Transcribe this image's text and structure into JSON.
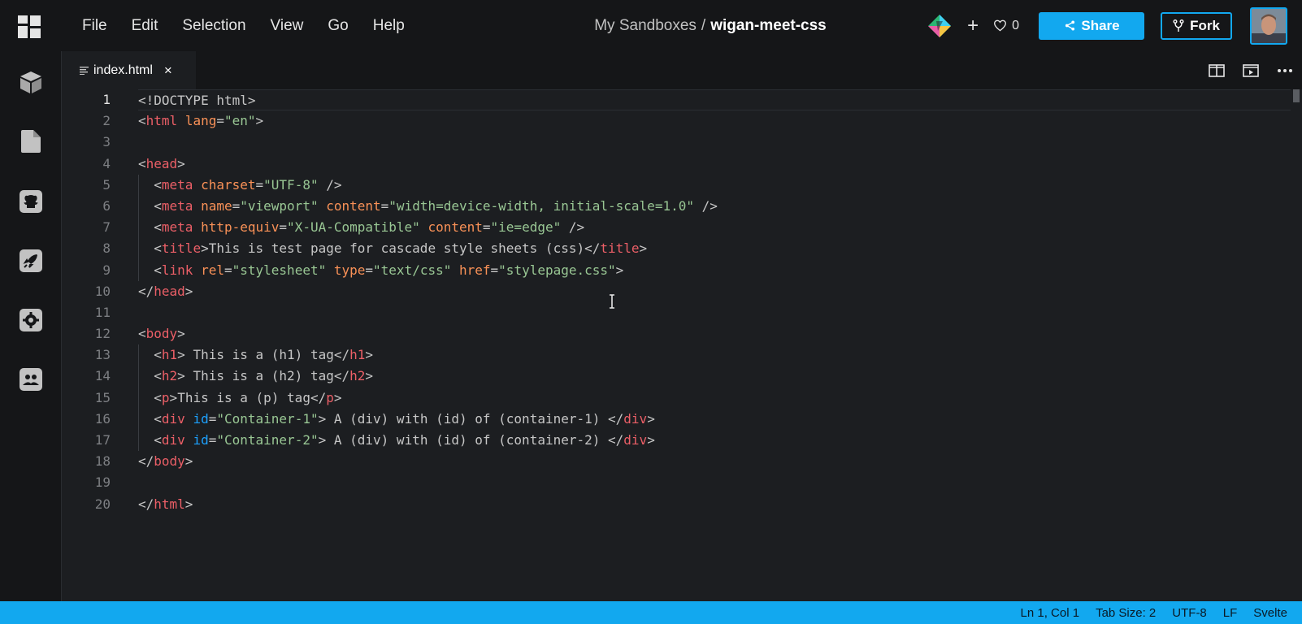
{
  "menubar": {
    "items": [
      "File",
      "Edit",
      "Selection",
      "View",
      "Go",
      "Help"
    ],
    "breadcrumb": {
      "parent": "My Sandboxes",
      "separator": "/",
      "name": "wigan-meet-css"
    },
    "likes": "0",
    "share_label": "Share",
    "fork_label": "Fork"
  },
  "activity_bar": {
    "icons": [
      "cube-icon",
      "file-icon",
      "github-icon",
      "rocket-icon",
      "gear-icon",
      "people-icon"
    ]
  },
  "tab": {
    "label": "index.html",
    "close": "×"
  },
  "editor": {
    "line_numbers": [
      "1",
      "2",
      "3",
      "4",
      "5",
      "6",
      "7",
      "8",
      "9",
      "10",
      "11",
      "12",
      "13",
      "14",
      "15",
      "16",
      "17",
      "18",
      "19",
      "20"
    ],
    "active_line": 1
  },
  "status": {
    "position": "Ln 1, Col 1",
    "tab_size": "Tab Size: 2",
    "encoding": "UTF-8",
    "eol": "LF",
    "language": "Svelte"
  },
  "colors": {
    "accent": "#12a8ef",
    "tag": "#ec5f67",
    "attribute": "#f99157",
    "id_attribute": "#1ca1ff",
    "string": "#99c794"
  }
}
